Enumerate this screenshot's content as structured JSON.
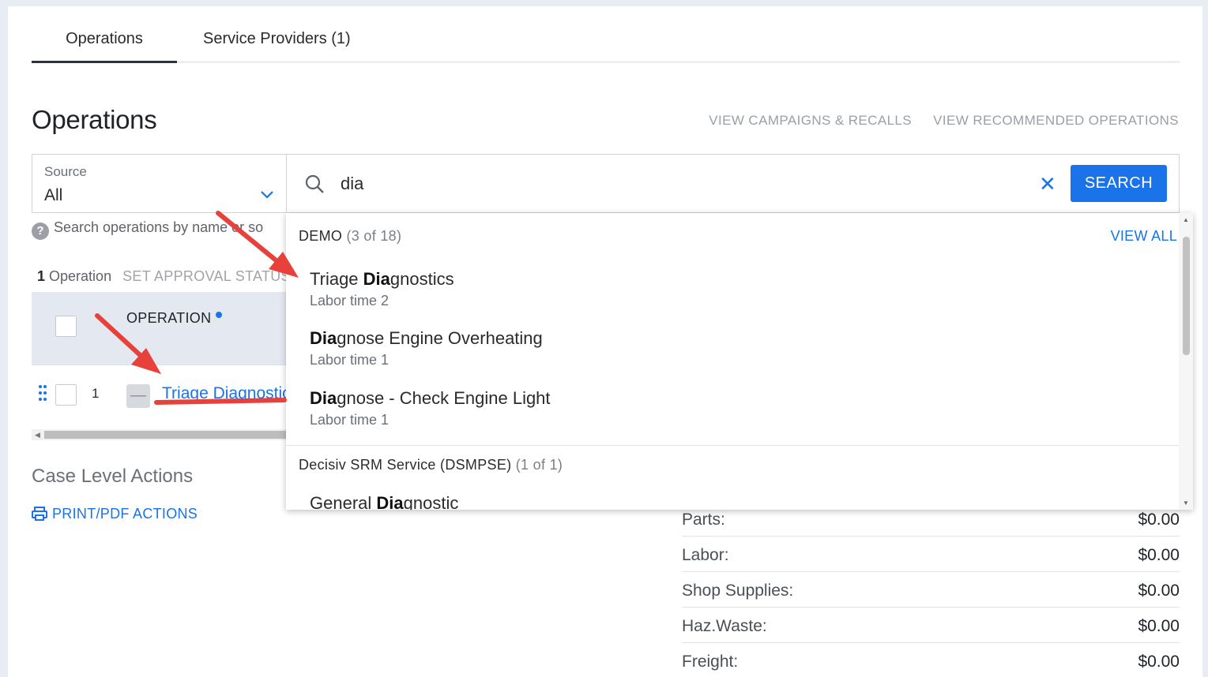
{
  "tabs": [
    {
      "label": "Operations"
    },
    {
      "label": "Service Providers (1)"
    }
  ],
  "page_title": "Operations",
  "top_links": {
    "campaigns": "VIEW CAMPAIGNS & RECALLS",
    "recommended": "VIEW RECOMMENDED OPERATIONS"
  },
  "source": {
    "label": "Source",
    "value": "All"
  },
  "search": {
    "value": "dia",
    "button": "SEARCH",
    "clear_glyph": "✕"
  },
  "hint": "Search operations by name or so",
  "summary": {
    "count": "1",
    "count_label": "Operation",
    "set_approval": "SET APPROVAL STATUS"
  },
  "table": {
    "header": "OPERATION",
    "rows": [
      {
        "num": "1",
        "collapse_glyph": "—",
        "name": "Triage Diagnostics"
      }
    ]
  },
  "case_actions": {
    "title": "Case Level Actions",
    "print": "PRINT/PDF ACTIONS"
  },
  "totals": [
    {
      "label": "Parts:",
      "value": "$0.00"
    },
    {
      "label": "Labor:",
      "value": "$0.00"
    },
    {
      "label": "Shop Supplies:",
      "value": "$0.00"
    },
    {
      "label": "Haz.Waste:",
      "value": "$0.00"
    },
    {
      "label": "Freight:",
      "value": "$0.00"
    }
  ],
  "dropdown": {
    "groups": [
      {
        "name": "DEMO",
        "count": "(3 of 18)",
        "view_all": "VIEW ALL",
        "items": [
          {
            "pre": "Triage ",
            "match": "Dia",
            "post": "gnostics",
            "sub": "Labor time 2"
          },
          {
            "pre": "",
            "match": "Dia",
            "post": "gnose Engine Overheating",
            "sub": "Labor time 1"
          },
          {
            "pre": "",
            "match": "Dia",
            "post": "gnose - Check Engine Light",
            "sub": "Labor time 1"
          }
        ]
      },
      {
        "name": "Decisiv SRM Service (DSMPSE)",
        "count": "(1 of 1)",
        "items": [
          {
            "pre": "General ",
            "match": "Dia",
            "post": "gnostic"
          }
        ]
      }
    ]
  },
  "icons": {
    "search": "search-icon",
    "chevron": "chevron-down-icon",
    "help": "help-icon",
    "drag": "drag-handle-icon",
    "print": "printer-icon"
  },
  "colors": {
    "accent": "#1a73e8",
    "arrow": "#e8403a",
    "header_bg": "#e4e8f1"
  }
}
